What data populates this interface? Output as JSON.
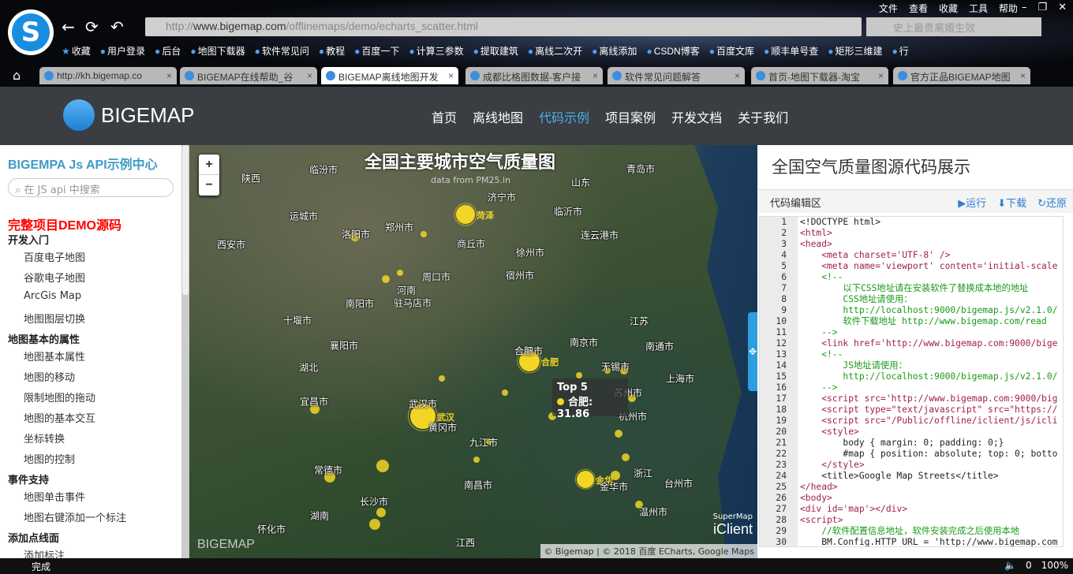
{
  "browser": {
    "menu": [
      "文件",
      "查看",
      "收藏",
      "工具",
      "帮助"
    ],
    "url_prefix": "http://",
    "url_host": "www.bigemap.com",
    "url_path": "/offlinemaps/demo/echarts_scatter.html",
    "search_placeholder": "史上最贵离婚生效",
    "bookmarks": [
      "收藏",
      "用户登录",
      "后台",
      "地图下载器",
      "软件常见问",
      "教程",
      "百度一下",
      "计算三参数",
      "提取建筑",
      "离线二次开",
      "离线添加",
      "CSDN博客",
      "百度文库",
      "顺丰单号查",
      "矩形三维建",
      "行"
    ],
    "tabs": [
      "http://kh.bigemap.co",
      "BIGEMAP在线帮助_谷",
      "BIGEMAP离线地图开发",
      "成都比格图数据-客户接",
      "软件常见问题解答",
      "首页-地图下载器-淘宝",
      "官方正品BIGEMAP地图"
    ],
    "status": "完成",
    "status_right": [
      "0",
      "100%"
    ]
  },
  "site": {
    "brand": "BIGEMAP",
    "nav": [
      "首页",
      "离线地图",
      "代码示例",
      "项目案例",
      "开发文档",
      "关于我们"
    ]
  },
  "sidebar": {
    "title": "BIGEMPA Js API示例中心",
    "search_placeholder": "在 JS api 中搜索",
    "items": [
      {
        "t": "red",
        "label": "完整项目DEMO源码"
      },
      {
        "t": "cat",
        "label": "开发入门"
      },
      {
        "t": "it",
        "label": "百度电子地图"
      },
      {
        "t": "it",
        "label": "谷歌电子地图"
      },
      {
        "t": "it",
        "label": "ArcGis Map"
      },
      {
        "t": "it",
        "label": "地图图层切换"
      },
      {
        "t": "cat",
        "label": "地图基本的属性"
      },
      {
        "t": "it",
        "label": "地图基本属性"
      },
      {
        "t": "it",
        "label": "地图的移动"
      },
      {
        "t": "it",
        "label": "限制地图的拖动"
      },
      {
        "t": "it",
        "label": "地图的基本交互"
      },
      {
        "t": "it",
        "label": "坐标转换"
      },
      {
        "t": "it",
        "label": "地图的控制"
      },
      {
        "t": "cat",
        "label": "事件支持"
      },
      {
        "t": "it",
        "label": "地图单击事件"
      },
      {
        "t": "it",
        "label": "地图右键添加一个标注"
      },
      {
        "t": "cat",
        "label": "添加点线面"
      },
      {
        "t": "it",
        "label": "添加标注"
      }
    ]
  },
  "map": {
    "title": "全国主要城市空气质量图",
    "subtitle": "data from PM25.in",
    "zoom_in": "+",
    "zoom_out": "−",
    "cities": [
      "陕西",
      "临汾市",
      "济宁市",
      "山东",
      "青岛市",
      "运城市",
      "郑州市",
      "临沂市",
      "洛阳市",
      "连云港市",
      "西安市",
      "商丘市",
      "徐州市",
      "周口市",
      "宿州市",
      "河南",
      "南阳市",
      "驻马店市",
      "十堰市",
      "江苏",
      "襄阳市",
      "合肥市",
      "南京市",
      "南通市",
      "湖北",
      "无锡市",
      "上海市",
      "苏州市",
      "宜昌市",
      "武汉市",
      "黄冈市",
      "杭州市",
      "九江市",
      "常德市",
      "浙江",
      "金华市",
      "台州市",
      "南昌市",
      "长沙市",
      "温州市",
      "湖南",
      "怀化市",
      "江西"
    ],
    "top5": [
      "菏泽",
      "合肥",
      "武汉",
      "金华"
    ],
    "tooltip": {
      "title": "Top 5",
      "label": "合肥: 31.86"
    },
    "attribution": "© Bigemap | © 2018 百度 ECharts, Google Maps",
    "watermark": "BIGEMAP",
    "iclient_small": "SuperMap",
    "iclient": "iClient"
  },
  "code": {
    "title": "全国空气质量图源代码展示",
    "editor_label": "代码编辑区",
    "run": "▶运行",
    "download": "⬇下载",
    "restore": "↻还原",
    "lines": [
      {
        "k": "tx",
        "s": "<!DOCTYPE html>"
      },
      {
        "k": "tag",
        "s": "<html>"
      },
      {
        "k": "tag",
        "s": "<head>"
      },
      {
        "k": "tag",
        "s": "    <meta charset='UTF-8' />"
      },
      {
        "k": "tag",
        "s": "    <meta name='viewport' content='initial-scale"
      },
      {
        "k": "cm",
        "s": "    <!--"
      },
      {
        "k": "cm",
        "s": "        以下CSS地址请在安装软件了替换成本地的地址"
      },
      {
        "k": "cm",
        "s": "        CSS地址请使用："
      },
      {
        "k": "cm",
        "s": "        http://localhost:9000/bigemap.js/v2.1.0/"
      },
      {
        "k": "cm",
        "s": "        软件下载地址 http://www.bigemap.com/read"
      },
      {
        "k": "cm",
        "s": "    -->"
      },
      {
        "k": "tag",
        "s": "    <link href='http://www.bigemap.com:9000/bige"
      },
      {
        "k": "cm",
        "s": "    <!--"
      },
      {
        "k": "cm",
        "s": "        JS地址请使用："
      },
      {
        "k": "cm",
        "s": "        http://localhost:9000/bigemap.js/v2.1.0/"
      },
      {
        "k": "cm",
        "s": "    -->"
      },
      {
        "k": "tag",
        "s": "    <script src='http://www.bigemap.com:9000/big"
      },
      {
        "k": "tag",
        "s": "    <script type=\"text/javascript\" src=\"https://"
      },
      {
        "k": "tag",
        "s": "    <script src=\"/Public/offline/iclient/js/icli"
      },
      {
        "k": "tag",
        "s": "    <style>"
      },
      {
        "k": "tx",
        "s": "        body { margin: 0; padding: 0;}"
      },
      {
        "k": "tx",
        "s": "        #map { position: absolute; top: 0; botto"
      },
      {
        "k": "tag",
        "s": "    </style>"
      },
      {
        "k": "tx",
        "s": "    <title>Google Map Streets</title>"
      },
      {
        "k": "tag",
        "s": "</head>"
      },
      {
        "k": "tag",
        "s": "<body>"
      },
      {
        "k": "tag",
        "s": "<div id='map'></div>"
      },
      {
        "k": "tag",
        "s": "<script>"
      },
      {
        "k": "cm",
        "s": "    //软件配置信息地址，软件安装完成之后使用本地"
      },
      {
        "k": "tx",
        "s": "    BM.Config.HTTP_URL = 'http://www.bigemap.com"
      }
    ]
  }
}
